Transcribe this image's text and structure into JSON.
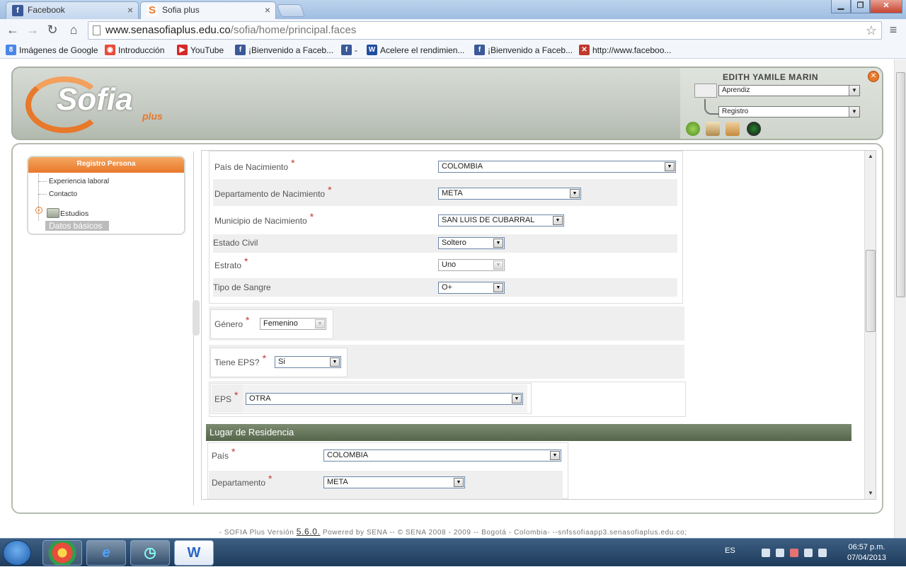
{
  "browser": {
    "tabs": [
      {
        "label": "Facebook",
        "icon": "facebook-icon",
        "active": false
      },
      {
        "label": "Sofia plus",
        "icon": "sofia-icon",
        "active": true
      }
    ],
    "url": {
      "host": "www.senasofiaplus.edu.co",
      "path": "/sofia/home/principal.faces"
    },
    "bookmarks": [
      {
        "label": "Imágenes de Google",
        "icon": "google-icon",
        "color": "#4a86e8"
      },
      {
        "label": "Introducción",
        "icon": "chrome-icon",
        "color": "#e74c3c"
      },
      {
        "label": "YouTube",
        "icon": "youtube-icon",
        "color": "#d62828"
      },
      {
        "label": "¡Bienvenido a Faceb...",
        "icon": "facebook-icon",
        "color": "#3b5998"
      },
      {
        "label": "-",
        "icon": "facebook-icon",
        "color": "#3b5998"
      },
      {
        "label": "Acelere el rendimien...",
        "icon": "w-icon",
        "color": "#1f4e9e"
      },
      {
        "label": "¡Bienvenido a Faceb...",
        "icon": "facebook-icon",
        "color": "#3b5998"
      },
      {
        "label": "http://www.faceboo...",
        "icon": "red-x-icon",
        "color": "#c0392b"
      }
    ]
  },
  "header": {
    "logo_text": "Sofia",
    "logo_plus": "plus",
    "username": "EDITH YAMILE MARIN",
    "role_select": "Aprendiz",
    "module_select": "Registro",
    "icons": [
      "help-icon",
      "book-icon",
      "home-icon",
      "power-icon"
    ]
  },
  "sidebar": {
    "title": "Registro Persona",
    "items": [
      "Experiencia laboral",
      "Contacto",
      "Estudios",
      "Datos básicos"
    ]
  },
  "form": {
    "pais_nac": {
      "label": "País de Nacimiento",
      "value": "COLOMBIA"
    },
    "depto_nac": {
      "label": "Departamento de Nacimiento",
      "value": "META"
    },
    "muni_nac": {
      "label": "Municipio de Nacimiento",
      "value": "SAN LUIS DE CUBARRAL"
    },
    "estado_civil": {
      "label": "Estado Civil",
      "value": "Soltero"
    },
    "estrato": {
      "label": "Estrato",
      "value": "Uno"
    },
    "tipo_sangre": {
      "label": "Tipo de Sangre",
      "value": "O+"
    },
    "genero": {
      "label": "Género",
      "value": "Femenino"
    },
    "tiene_eps": {
      "label": "Tiene EPS?",
      "value": "Si"
    },
    "eps": {
      "label": "EPS",
      "value": "OTRA"
    },
    "residencia_title": "Lugar de Residencia",
    "pais_res": {
      "label": "País",
      "value": "COLOMBIA"
    },
    "depto_res": {
      "label": "Departamento",
      "value": "META"
    },
    "required_mark": "*"
  },
  "footer": {
    "prefix": "- SOFIA Plus Versión",
    "version": "5.6.0.",
    "suffix": "Powered by SENA -- © SENA 2008 - 2009 -- Bogotá - Colombia- --snfssofiaapp3.senasofiaplus.edu.co;"
  },
  "taskbar": {
    "lang": "ES",
    "time": "06:57 p.m.",
    "date": "07/04/2013"
  }
}
